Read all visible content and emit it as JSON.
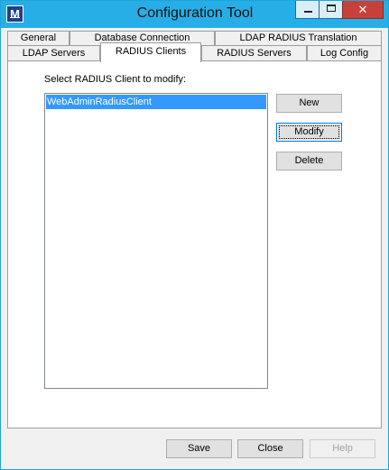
{
  "window": {
    "title": "Configuration Tool",
    "app_icon_letter": "M",
    "accent_color": "#27aee6",
    "close_glyph": "✕"
  },
  "tabs": {
    "row1": [
      {
        "label": "General"
      },
      {
        "label": "Database Connection"
      },
      {
        "label": "LDAP RADIUS Translation"
      }
    ],
    "row2": [
      {
        "label": "LDAP Servers"
      },
      {
        "label": "RADIUS Clients",
        "active": true
      },
      {
        "label": "RADIUS Servers"
      },
      {
        "label": "Log Config"
      }
    ]
  },
  "panel": {
    "prompt": "Select RADIUS Client to modify:",
    "clients": [
      {
        "name": "WebAdminRadiusClient",
        "selected": true
      }
    ],
    "buttons": {
      "new": "New",
      "modify": "Modify",
      "delete": "Delete"
    }
  },
  "footer": {
    "save": "Save",
    "close": "Close",
    "help": "Help",
    "help_disabled": true
  },
  "colors": {
    "selection": "#3399ff",
    "dialog_bg": "#f0f0f0"
  }
}
